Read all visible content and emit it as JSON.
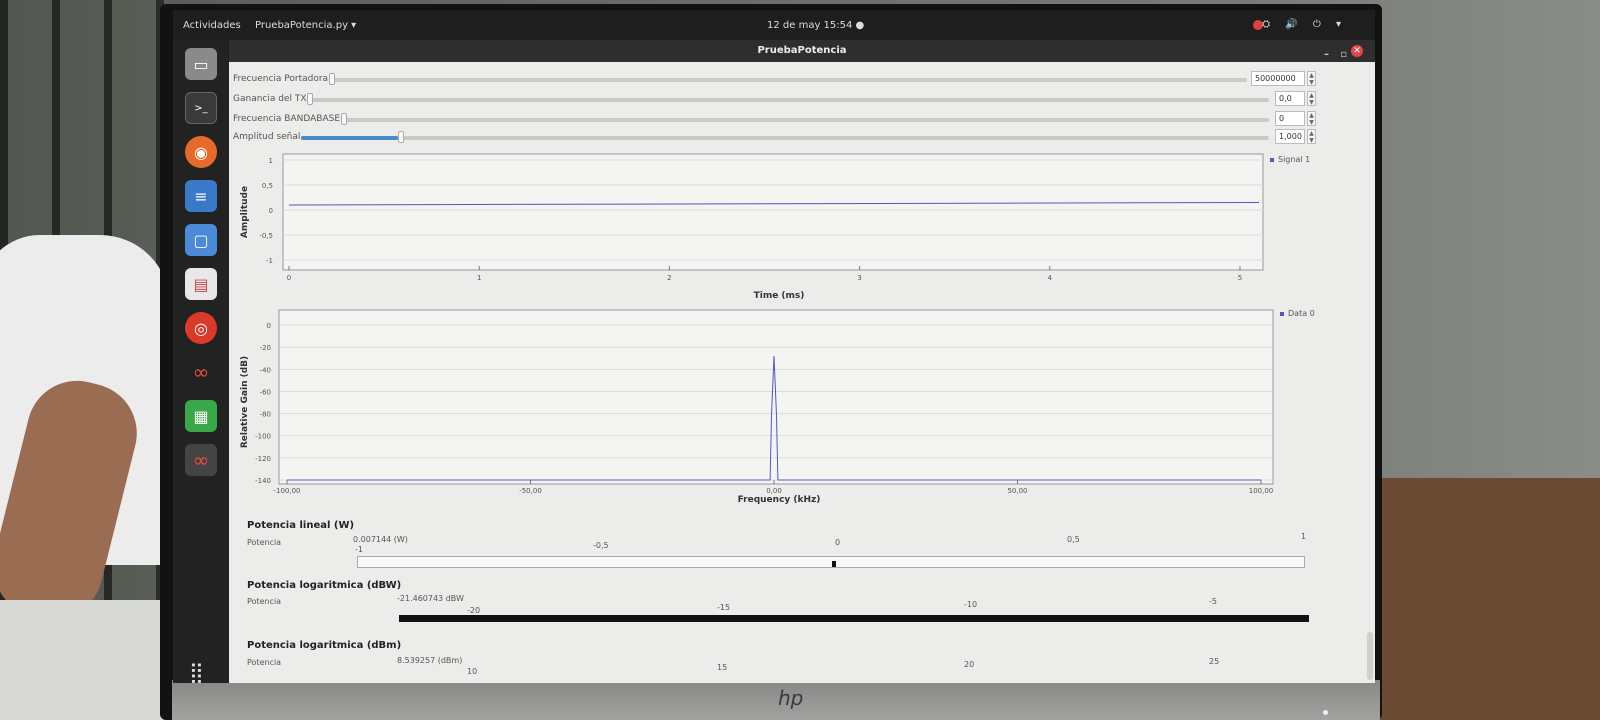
{
  "topbar": {
    "activities": "Actividades",
    "app_menu": "PruebaPotencia.py ▾",
    "clock": "12 de may  15:54  ●",
    "tray_icons": "⛭ 🔊 ⏻ ▾"
  },
  "window": {
    "title": "PruebaPotencia",
    "minimize": "–",
    "maximize": "▫",
    "close": "✕"
  },
  "dock": {
    "items": [
      "files-icon",
      "terminal-icon",
      "firefox-icon",
      "writer-icon",
      "remmina-icon",
      "impress-icon",
      "chrome-icon",
      "gnuradio-icon",
      "calc-icon",
      "gnuradio-active-icon"
    ],
    "apps_grid": "⣿"
  },
  "params": [
    {
      "label": "Frecuencia Portadora",
      "value": "50000000",
      "level": 0
    },
    {
      "label": "Ganancia del TX",
      "value": "0,0",
      "level": 0
    },
    {
      "label": "Frecuencia BANDABASE",
      "value": "0",
      "level": 0
    },
    {
      "label": "Amplitud señal",
      "value": "1,000",
      "level": 0.1
    }
  ],
  "time_plot": {
    "ylabel": "Amplitude",
    "xlabel": "Time (ms)",
    "legend": "Signal 1",
    "yticks": [
      "1",
      "0,5",
      "0",
      "-0,5",
      "-1"
    ],
    "xticks": [
      "0",
      "1",
      "2",
      "3",
      "4",
      "5"
    ]
  },
  "freq_plot": {
    "ylabel": "Relative Gain (dB)",
    "xlabel": "Frequency (kHz)",
    "legend": "Data 0",
    "yticks": [
      "0",
      "-20",
      "-40",
      "-60",
      "-80",
      "-100",
      "-120",
      "-140"
    ],
    "xticks": [
      "-100,00",
      "-50,00",
      "0,00",
      "50,00",
      "100,00"
    ]
  },
  "chart_data": [
    {
      "type": "line",
      "title": "",
      "xlabel": "Time (ms)",
      "ylabel": "Amplitude",
      "xlim": [
        0,
        5.1
      ],
      "ylim": [
        -1,
        1
      ],
      "series": [
        {
          "name": "Signal 1",
          "x": [
            0,
            5.1
          ],
          "y": [
            0.1,
            0.15
          ]
        }
      ],
      "legend": "top-right",
      "grid": true
    },
    {
      "type": "line",
      "title": "",
      "xlabel": "Frequency (kHz)",
      "ylabel": "Relative Gain (dB)",
      "xlim": [
        -100,
        100
      ],
      "ylim": [
        -140,
        10
      ],
      "series": [
        {
          "name": "Data 0",
          "x": [
            -100,
            -0.8,
            -0.5,
            0,
            0.5,
            0.8,
            100
          ],
          "y": [
            -140,
            -140,
            -80,
            -28,
            -80,
            -140,
            -140
          ]
        }
      ],
      "legend": "top-right",
      "grid": true
    }
  ],
  "linear_power": {
    "title": "Potencia lineal (W)",
    "label": "Potencia",
    "value_text": "0.007144 (W)",
    "ticks": [
      "-1",
      "-0,5",
      "0",
      "0,5",
      "1"
    ],
    "value": 0.007144
  },
  "log_power_dbw": {
    "title": "Potencia logaritmica (dBW)",
    "label": "Potencia",
    "value_text": "-21.460743 dBW",
    "ticks": [
      "-20",
      "-15",
      "-10",
      "-5"
    ],
    "value": -21.460743
  },
  "log_power_dbm": {
    "title": "Potencia logaritmica (dBm)",
    "label": "Potencia",
    "value_text": "8.539257 (dBm)",
    "ticks": [
      "10",
      "15",
      "20",
      "25"
    ],
    "value": 8.539257
  }
}
